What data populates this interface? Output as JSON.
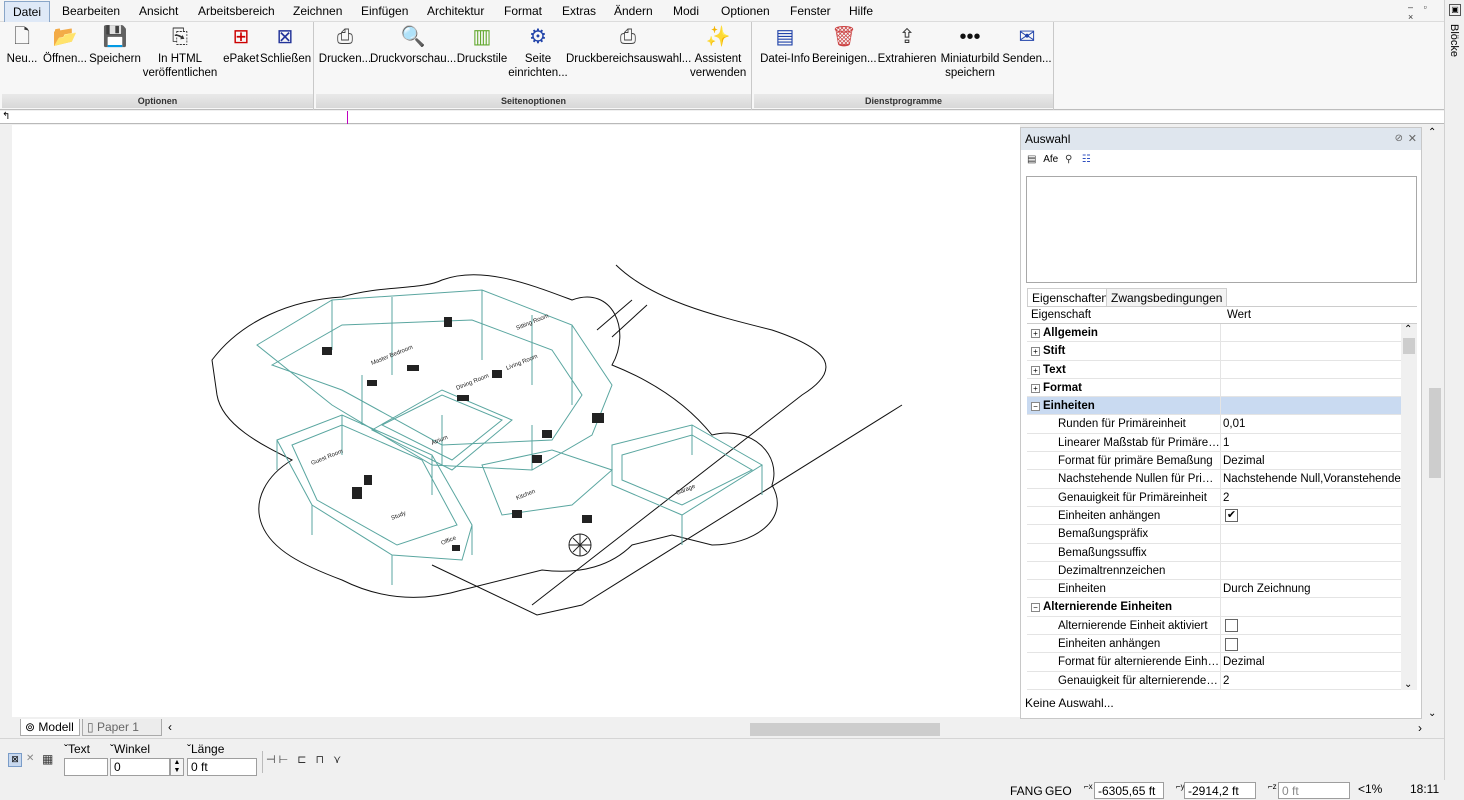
{
  "menu": [
    "Datei",
    "Bearbeiten",
    "Ansicht",
    "Arbeitsbereich",
    "Zeichnen",
    "Einfügen",
    "Architektur",
    "Format",
    "Extras",
    "Ändern",
    "Modi",
    "Optionen",
    "Fenster",
    "Hilfe"
  ],
  "window_controls": "– ▫ ×",
  "ribbon": {
    "groups": [
      "Optionen",
      "Seitenoptionen",
      "Dienstprogramme"
    ],
    "buttons": [
      "Neu...",
      "Öffnen...",
      "Speichern",
      "In HTML veröffentlichen",
      "ePaket",
      "Schließen",
      "Drucken...",
      "Druckvorschau...",
      "Druckstile",
      "Seite einrichten...",
      "Druckbereichsauswahl...",
      "Assistent verwenden",
      "Datei-Info",
      "Bereinigen...",
      "Extrahieren",
      "Miniaturbild speichern",
      "Senden..."
    ]
  },
  "side_panel_label": "Blöcke",
  "panel": {
    "title": "Auswahl",
    "tools": "Afe",
    "tabs": [
      "Eigenschaften",
      "Zwangsbedingungen"
    ],
    "header": {
      "name": "Eigenschaft",
      "value": "Wert"
    },
    "rows": [
      {
        "name": "Allgemein",
        "value": "",
        "type": "cat",
        "expanded": false
      },
      {
        "name": "Stift",
        "value": "",
        "type": "cat",
        "expanded": false
      },
      {
        "name": "Text",
        "value": "",
        "type": "cat",
        "expanded": false
      },
      {
        "name": "Format",
        "value": "",
        "type": "cat",
        "expanded": false
      },
      {
        "name": "Einheiten",
        "value": "",
        "type": "cat",
        "expanded": true,
        "selected": true
      },
      {
        "name": "Runden für Primäreinheit",
        "value": "0,01",
        "type": "sub"
      },
      {
        "name": "Linearer Maßstab für Primäreinheit",
        "value": "1",
        "type": "sub"
      },
      {
        "name": "Format für primäre Bemaßung",
        "value": "Dezimal",
        "type": "sub"
      },
      {
        "name": "Nachstehende Nullen für Primäreinheit",
        "value": "Nachstehende Null,Voranstehende Null",
        "type": "sub"
      },
      {
        "name": "Genauigkeit für Primäreinheit",
        "value": "2",
        "type": "sub"
      },
      {
        "name": "Einheiten anhängen",
        "value": "",
        "type": "sub",
        "check": true
      },
      {
        "name": "Bemaßungspräfix",
        "value": "",
        "type": "sub"
      },
      {
        "name": "Bemaßungssuffix",
        "value": "",
        "type": "sub"
      },
      {
        "name": "Dezimaltrennzeichen",
        "value": "",
        "type": "sub"
      },
      {
        "name": "Einheiten",
        "value": "Durch Zeichnung",
        "type": "sub"
      },
      {
        "name": "Alternierende Einheiten",
        "value": "",
        "type": "cat",
        "expanded": true
      },
      {
        "name": "Alternierende Einheit aktiviert",
        "value": "",
        "type": "sub",
        "check": false
      },
      {
        "name": "Einheiten anhängen",
        "value": "",
        "type": "sub",
        "check": false
      },
      {
        "name": "Format für alternierende Einheiten",
        "value": "Dezimal",
        "type": "sub"
      },
      {
        "name": "Genauigkeit für alternierende Einheiten",
        "value": "2",
        "type": "sub"
      }
    ],
    "status": "Keine Auswahl..."
  },
  "layout_tabs": [
    "Modell",
    "Paper 1"
  ],
  "cmd": {
    "text_label": "Text",
    "winkel_label": "Winkel",
    "laenge_label": "Länge",
    "winkel_value": "0",
    "laenge_value": "0 ft"
  },
  "status": {
    "fang": "FANG",
    "geo": "GEO",
    "x": "-6305,65 ft",
    "y": "-2914,2 ft",
    "z": "0 ft",
    "zoom": "<1%",
    "time": "18:11"
  },
  "drawing_labels": [
    "Atrium",
    "Garage",
    "Dining Room",
    "Living Room",
    "Sitting Room",
    "Master Bedroom",
    "Kitchen",
    "Bath",
    "Closet",
    "Guest Room",
    "Powder Room",
    "Laundry",
    "Study",
    "Office",
    "Entry"
  ],
  "colors": {
    "accent": "#dfe9f7",
    "wall": "#5aa6a0",
    "selected_row": "#c9daf1"
  }
}
